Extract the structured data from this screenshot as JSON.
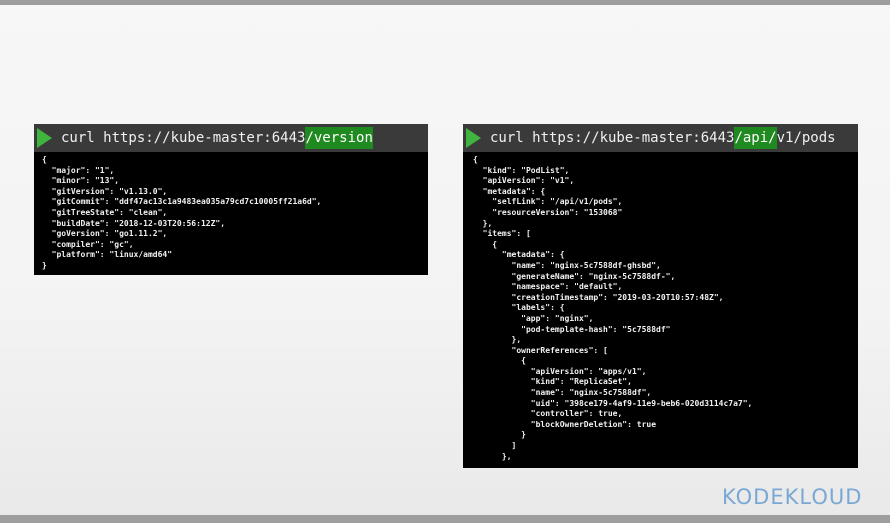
{
  "left_terminal": {
    "command_prefix": "curl https://kube-master:6443",
    "command_highlight": "/version",
    "command_suffix": "",
    "output": "{\n  \"major\": \"1\",\n  \"minor\": \"13\",\n  \"gitVersion\": \"v1.13.0\",\n  \"gitCommit\": \"ddf47ac13c1a9483ea035a79cd7c10005ff21a6d\",\n  \"gitTreeState\": \"clean\",\n  \"buildDate\": \"2018-12-03T20:56:12Z\",\n  \"goVersion\": \"go1.11.2\",\n  \"compiler\": \"gc\",\n  \"platform\": \"linux/amd64\"\n}"
  },
  "right_terminal": {
    "command_prefix": "curl https://kube-master:6443",
    "command_highlight": "/api/",
    "command_suffix": "v1/pods",
    "output": "{\n  \"kind\": \"PodList\",\n  \"apiVersion\": \"v1\",\n  \"metadata\": {\n    \"selfLink\": \"/api/v1/pods\",\n    \"resourceVersion\": \"153068\"\n  },\n  \"items\": [\n    {\n      \"metadata\": {\n        \"name\": \"nginx-5c7588df-ghsbd\",\n        \"generateName\": \"nginx-5c7588df-\",\n        \"namespace\": \"default\",\n        \"creationTimestamp\": \"2019-03-20T10:57:48Z\",\n        \"labels\": {\n          \"app\": \"nginx\",\n          \"pod-template-hash\": \"5c7588df\"\n        },\n        \"ownerReferences\": [\n          {\n            \"apiVersion\": \"apps/v1\",\n            \"kind\": \"ReplicaSet\",\n            \"name\": \"nginx-5c7588df\",\n            \"uid\": \"398ce179-4af9-11e9-beb6-020d3114c7a7\",\n            \"controller\": true,\n            \"blockOwnerDeletion\": true\n          }\n        ]\n      },"
  },
  "logo": {
    "text": "KODEKLOUD"
  },
  "colors": {
    "terminal_bg": "#000000",
    "terminal_header": "#3a3a3a",
    "play_icon": "#3fb53f",
    "highlight": "#1f8a1f",
    "logo": "#7aa8d4"
  },
  "icons": [
    "play-icon"
  ]
}
